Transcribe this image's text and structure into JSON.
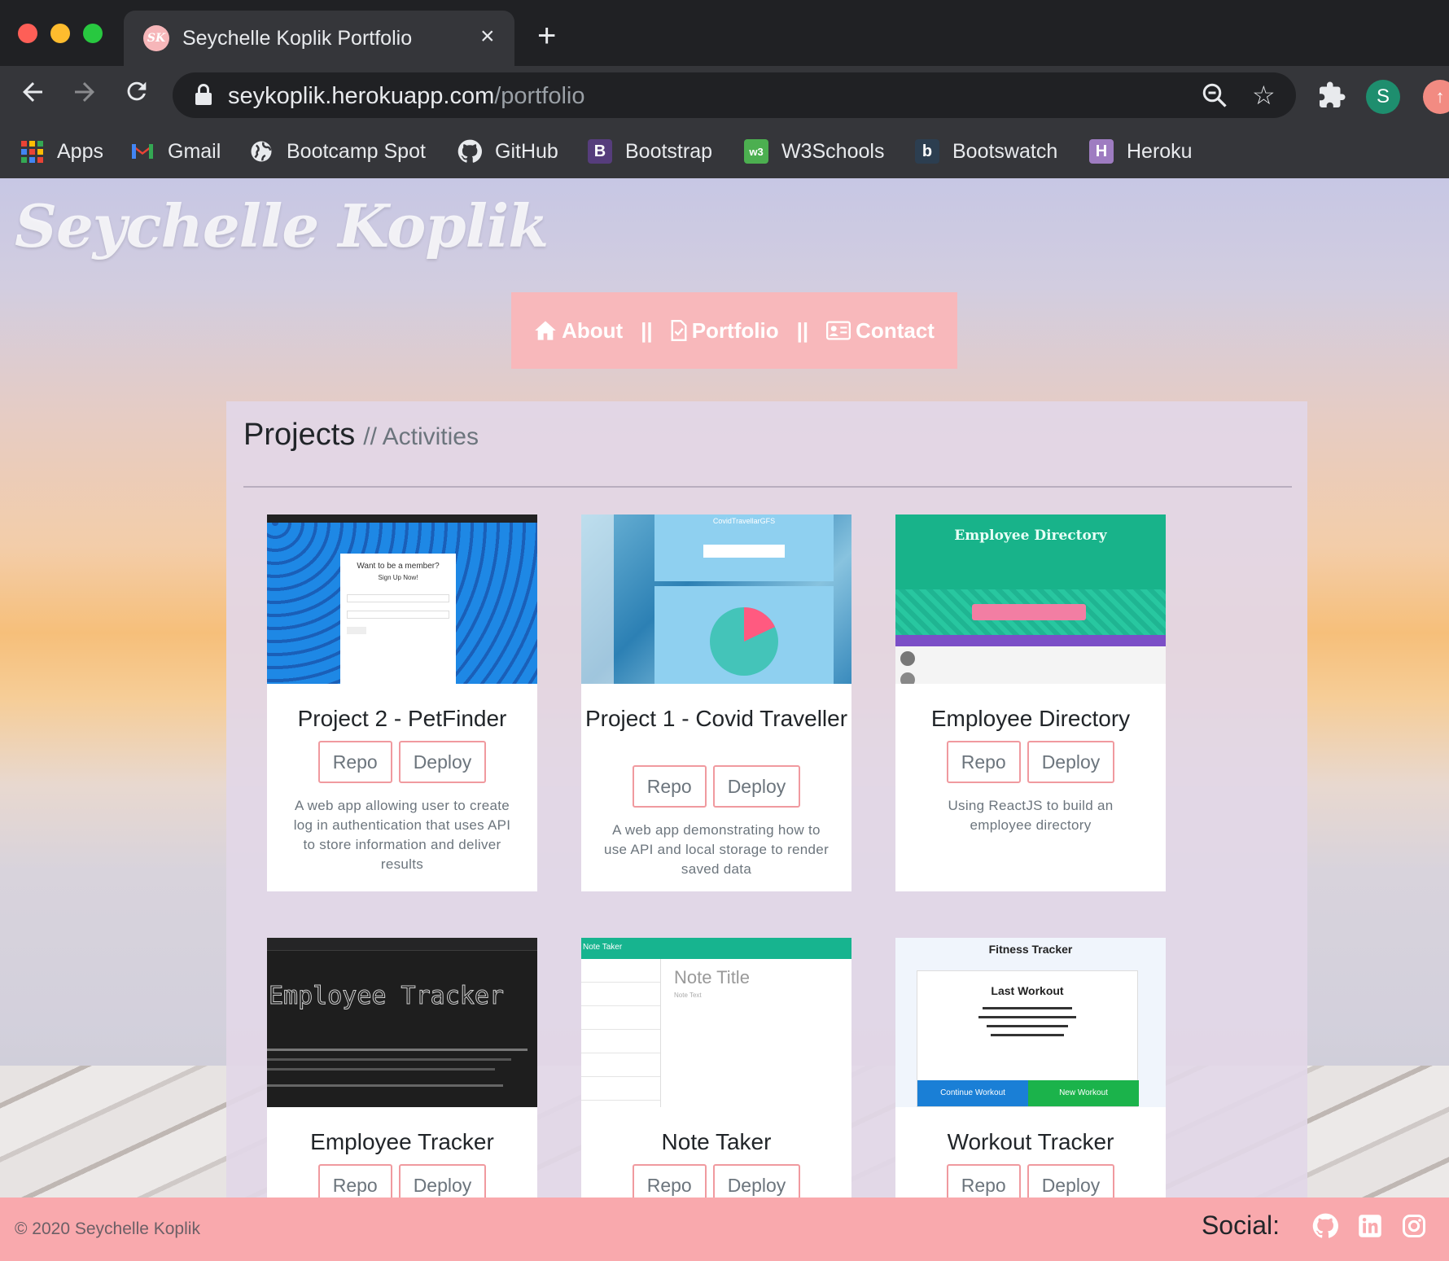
{
  "browser": {
    "tab_title": "Seychelle Koplik Portfolio",
    "tab_favicon_text": "SK",
    "close_glyph": "×",
    "new_tab_glyph": "+",
    "url_host": "seykoplik.herokuapp.com",
    "url_path": "/portfolio",
    "profile_initial": "S",
    "bookmarks": [
      {
        "label": "Apps",
        "icon": "apps-grid-icon"
      },
      {
        "label": "Gmail",
        "icon": "gmail-icon"
      },
      {
        "label": "Bootcamp Spot",
        "icon": "globe-icon"
      },
      {
        "label": "GitHub",
        "icon": "github-icon"
      },
      {
        "label": "Bootstrap",
        "icon": "bootstrap-icon"
      },
      {
        "label": "W3Schools",
        "icon": "w3schools-icon"
      },
      {
        "label": "Bootswatch",
        "icon": "bootswatch-icon"
      },
      {
        "label": "Heroku",
        "icon": "heroku-icon"
      }
    ]
  },
  "site": {
    "brand": "Seychelle Koplik",
    "nav": {
      "about": "About",
      "portfolio": "Portfolio",
      "contact": "Contact",
      "separator": "||"
    },
    "heading": "Projects",
    "subheading": "// Activities",
    "projects": [
      {
        "title": "Project 2 - PetFinder",
        "repo": "Repo",
        "deploy": "Deploy",
        "description": "A web app allowing user to create log in authentication that uses API to store information and deliver results",
        "thumb_text": "Want to be a member?"
      },
      {
        "title": "Project 1 - Covid Traveller",
        "repo": "Repo",
        "deploy": "Deploy",
        "description": "A web app demonstrating how to use API and local storage to render saved data",
        "thumb_text": "CovidTravellarGFS"
      },
      {
        "title": "Employee Directory",
        "repo": "Repo",
        "deploy": "Deploy",
        "description": "Using ReactJS to build an employee directory",
        "thumb_text": "Employee Directory"
      },
      {
        "title": "Employee Tracker",
        "repo": "Repo",
        "deploy": "Deploy",
        "description": "",
        "thumb_text": "Employee Tracker"
      },
      {
        "title": "Note Taker",
        "repo": "Repo",
        "deploy": "Deploy",
        "description": "",
        "thumb_text": "Note Title"
      },
      {
        "title": "Workout Tracker",
        "repo": "Repo",
        "deploy": "Deploy",
        "description": "",
        "thumb_text": "Fitness Tracker"
      }
    ],
    "thumb_extra": {
      "fitness_sub": "Last Workout",
      "fitness_continue": "Continue Workout",
      "fitness_new": "New Workout",
      "note_header": "Note Taker",
      "note_text": "Note Text",
      "petfinder_sub": "Sign Up Now!"
    },
    "footer": {
      "copyright": "© 2020 Seychelle Koplik",
      "social_label": "Social:"
    }
  },
  "colors": {
    "accent_pink": "#f8b8bb",
    "footer_pink": "#f9a9ad",
    "button_border": "#f09a9f"
  }
}
